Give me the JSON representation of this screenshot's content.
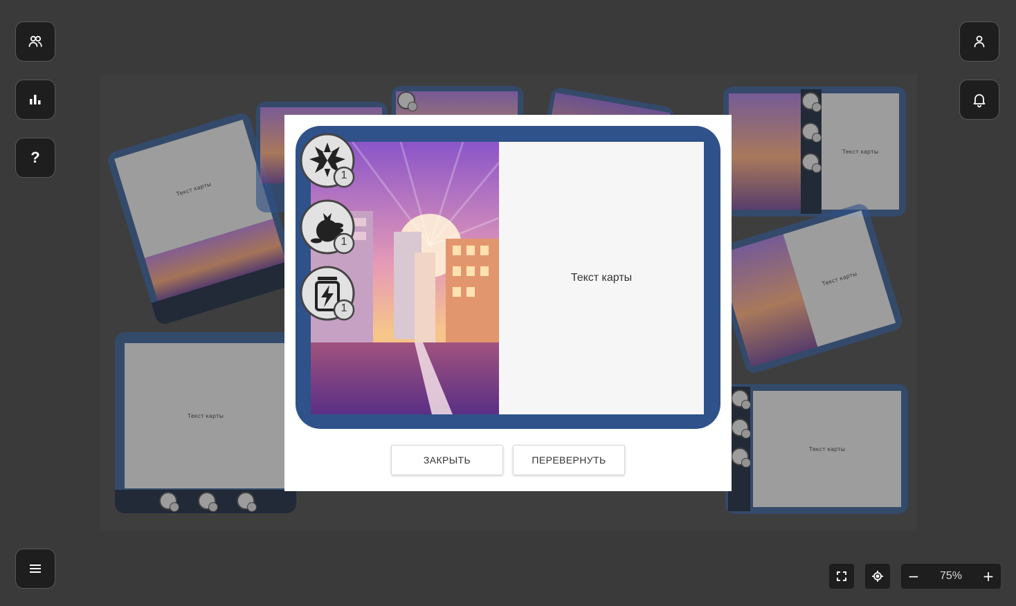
{
  "board": {
    "card_text": "Текст карты"
  },
  "modal": {
    "card": {
      "text": "Текст карты",
      "resources": [
        {
          "icon": "explosion-hourglass-icon",
          "count": "1"
        },
        {
          "icon": "money-bag-coins-icon",
          "count": "1"
        },
        {
          "icon": "energy-battery-icon",
          "count": "1"
        }
      ]
    },
    "close_label": "ЗАКРЫТЬ",
    "flip_label": "ПЕРЕВЕРНУТЬ"
  },
  "zoom": {
    "minus": "−",
    "value": "75%",
    "plus": "+"
  },
  "help_label": "?",
  "colors": {
    "background": "#3a3a3a",
    "card_border": "#2e5289",
    "button_bg": "#1e1e1e"
  }
}
